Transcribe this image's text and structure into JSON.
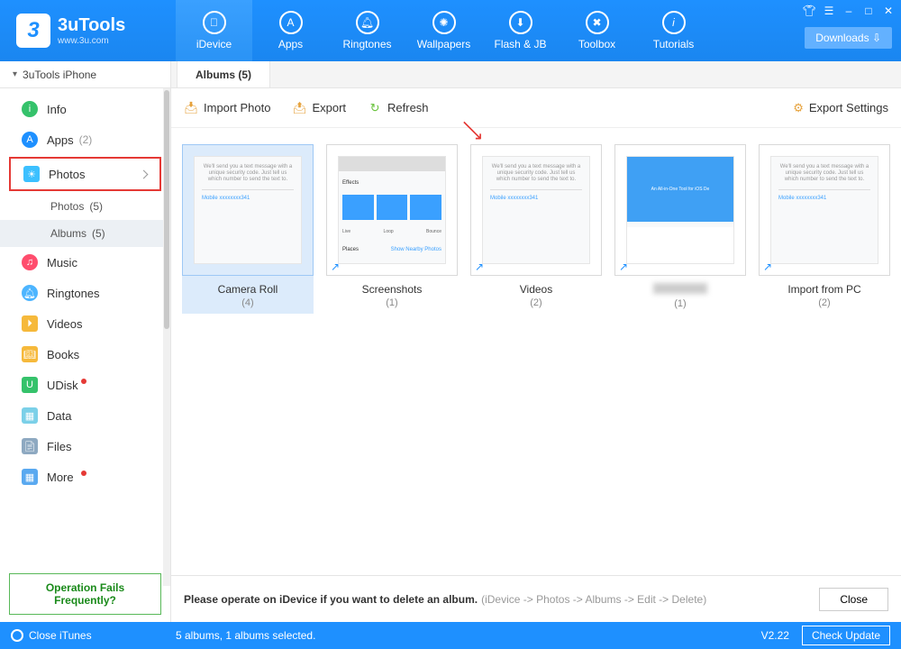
{
  "app": {
    "name": "3uTools",
    "site": "www.3u.com"
  },
  "tabs": [
    "iDevice",
    "Apps",
    "Ringtones",
    "Wallpapers",
    "Flash & JB",
    "Toolbox",
    "Tutorials"
  ],
  "downloads_label": "Downloads",
  "device_header": "3uTools iPhone",
  "nav": {
    "info": "Info",
    "apps": "Apps",
    "apps_count": "(2)",
    "photos": "Photos",
    "photos_sub": "Photos",
    "photos_sub_count": "(5)",
    "albums_sub": "Albums",
    "albums_sub_count": "(5)",
    "music": "Music",
    "ringtones": "Ringtones",
    "videos": "Videos",
    "books": "Books",
    "udisk": "UDisk",
    "data": "Data",
    "files": "Files",
    "more": "More"
  },
  "op_fail": "Operation Fails Frequently?",
  "subtab": "Albums (5)",
  "toolbar": {
    "import": "Import Photo",
    "export": "Export",
    "refresh": "Refresh",
    "export_settings": "Export Settings"
  },
  "albums": [
    {
      "title": "Camera Roll",
      "count": "(4)",
      "selected": true,
      "shortcut": false
    },
    {
      "title": "Screenshots",
      "count": "(1)",
      "selected": false,
      "shortcut": true
    },
    {
      "title": "Videos",
      "count": "(2)",
      "selected": false,
      "shortcut": true
    },
    {
      "title": "",
      "count": "(1)",
      "selected": false,
      "shortcut": true,
      "blurred": true
    },
    {
      "title": "Import from PC",
      "count": "(2)",
      "selected": false,
      "shortcut": true
    }
  ],
  "hint": {
    "msg": "Please operate on iDevice if you want to delete an album.",
    "path": "(iDevice -> Photos -> Albums -> Edit -> Delete)",
    "close": "Close"
  },
  "footer": {
    "close_itunes": "Close iTunes",
    "status": "5 albums, 1 albums selected.",
    "version": "V2.22",
    "check_update": "Check Update"
  }
}
